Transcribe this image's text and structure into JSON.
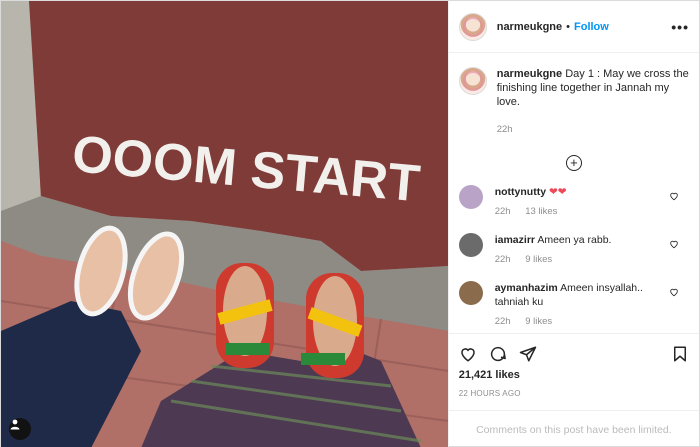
{
  "header": {
    "username": "narmeukgne",
    "separator": "•",
    "follow_label": "Follow",
    "more_label": "•••"
  },
  "photo": {
    "painted_text": "OOOM START",
    "tag_icon": "person-tag-icon"
  },
  "caption": {
    "username": "narmeukgne",
    "text": "Day 1 : May we cross the finishing line together in Jannah my love.",
    "time": "22h"
  },
  "load_more_label": "+",
  "comments": [
    {
      "username": "nottynutty",
      "text": "",
      "emoji": "❤❤",
      "time": "22h",
      "likes": "13 likes",
      "avatar_color": "#b9a3c7"
    },
    {
      "username": "iamazirr",
      "text": "Ameen ya rabb.",
      "emoji": "",
      "time": "22h",
      "likes": "9 likes",
      "avatar_color": "#6b6b6b"
    },
    {
      "username": "aymanhazim",
      "text": "Ameen insyallah.. tahniah ku",
      "emoji": "",
      "time": "22h",
      "likes": "9 likes",
      "avatar_color": "#8a6b4b"
    }
  ],
  "likes_count": "21,421 likes",
  "date_label": "22 HOURS AGO",
  "limited_notice": "Comments on this post have been limited.",
  "colors": {
    "accent": "#0095f6",
    "heart": "#ed4956"
  }
}
